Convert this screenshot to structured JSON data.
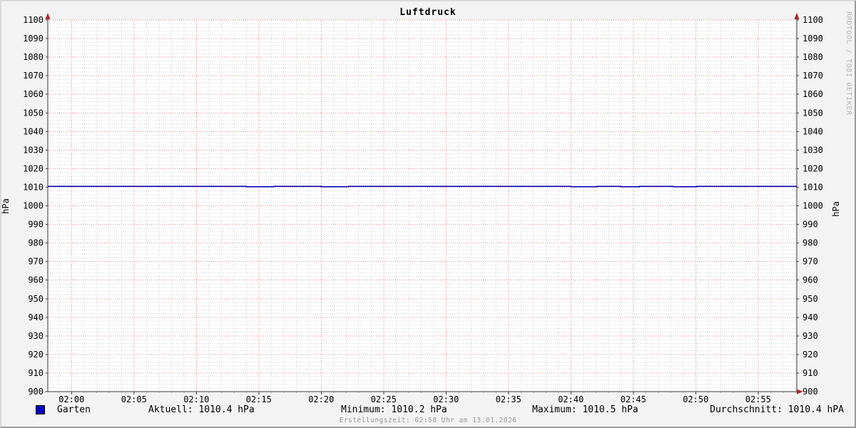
{
  "chart_data": {
    "type": "line",
    "title": "Luftdruck",
    "ylabel_left": "hPa",
    "ylabel_right": "hPa",
    "ylim": [
      900,
      1100
    ],
    "y_major_step": 10,
    "y_minor_step": 2,
    "x_range_min": [
      118.1,
      178.1
    ],
    "x_minor_step_min": 1,
    "grid": true,
    "x_major_ticks": [
      [
        120,
        "02:00"
      ],
      [
        125,
        "02:05"
      ],
      [
        130,
        "02:10"
      ],
      [
        135,
        "02:15"
      ],
      [
        140,
        "02:20"
      ],
      [
        145,
        "02:25"
      ],
      [
        150,
        "02:30"
      ],
      [
        155,
        "02:35"
      ],
      [
        160,
        "02:40"
      ],
      [
        165,
        "02:45"
      ],
      [
        170,
        "02:50"
      ],
      [
        175,
        "02:55"
      ]
    ],
    "series": [
      {
        "name": "Garten",
        "color": "#0000bb",
        "unit": "hPa",
        "points_min_hpa": [
          [
            118.1,
            1010.4
          ],
          [
            134.0,
            1010.3
          ],
          [
            136.2,
            1010.4
          ],
          [
            140.0,
            1010.3
          ],
          [
            142.2,
            1010.4
          ],
          [
            160.0,
            1010.2
          ],
          [
            162.1,
            1010.4
          ],
          [
            164.0,
            1010.3
          ],
          [
            165.5,
            1010.5
          ],
          [
            168.2,
            1010.3
          ],
          [
            170.1,
            1010.5
          ],
          [
            172.2,
            1010.4
          ],
          [
            178.1,
            1010.4
          ]
        ],
        "stats": {
          "aktuell": 1010.4,
          "minimum": 1010.2,
          "maximum": 1010.5,
          "durchschnitt": 1010.4
        }
      }
    ]
  },
  "legend": {
    "series_label": "Garten",
    "swatch_color": "#0000cc",
    "aktuell": "Aktuell: 1010.4 hPa",
    "minimum": "Minimum: 1010.2 hPa",
    "maximum": "Maximum: 1010.5 hPa",
    "durchschnitt": "Durchschnitt: 1010.4 hPA"
  },
  "footer": {
    "created": "Erstellungszeit: 02:58 Uhr am 13.01.2026"
  },
  "watermark": "RRDTOOL / TOBI OETIKER",
  "colors": {
    "background": "#f3f3f3",
    "canvas": "#ffffff",
    "major_grid": "#e08888",
    "minor_grid": "#d2d2d2",
    "axis": "#3a3a3a",
    "arrow": "#a82a2a",
    "line": "#0000bb",
    "text": "#000000",
    "footer_text": "#979797",
    "watermark_text": "#b5b5b5"
  }
}
